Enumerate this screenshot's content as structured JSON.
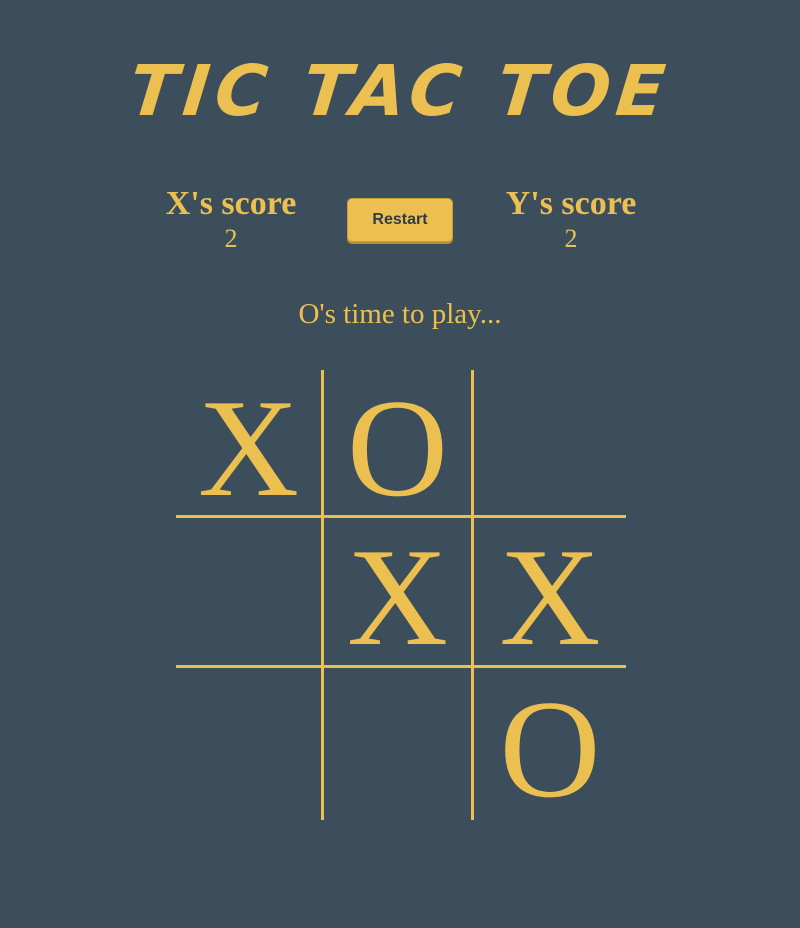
{
  "title": "TIC TAC TOE",
  "scores": {
    "x_label": "X's score",
    "x_value": "2",
    "y_label": "Y's score",
    "y_value": "2"
  },
  "restart_label": "Restart",
  "status": "O's time to play...",
  "board": {
    "cells": [
      "X",
      "O",
      "",
      "",
      "X",
      "X",
      "",
      "",
      "O"
    ]
  },
  "colors": {
    "background": "#3c4d5c",
    "accent": "#ecc050"
  }
}
